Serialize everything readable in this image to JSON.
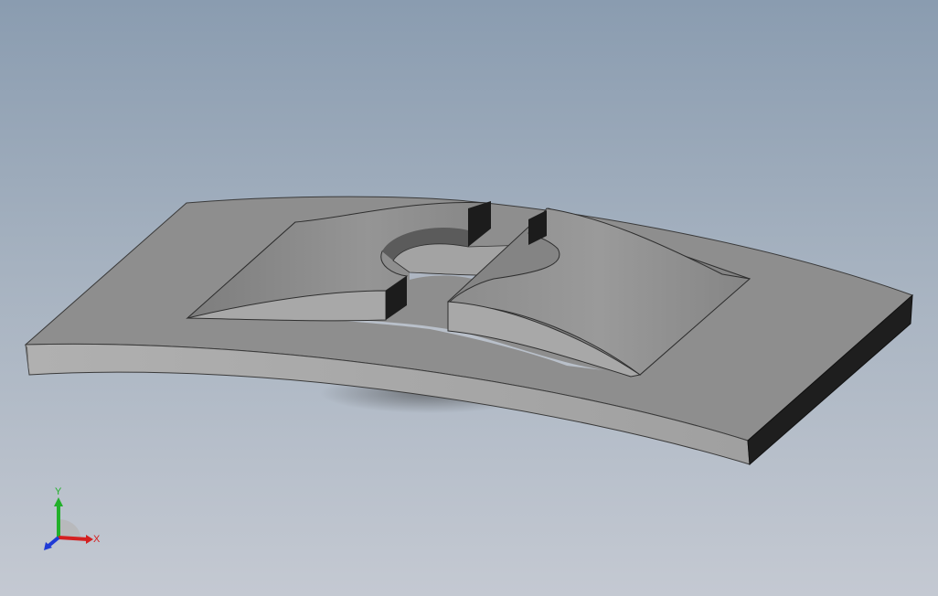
{
  "triad": {
    "x_label": "X",
    "y_label": "Y",
    "x_color": "#d42020",
    "y_color": "#22b02a",
    "z_color": "#1f3ad6"
  },
  "colors": {
    "background_top": "#8a9cb0",
    "background_bottom": "#c4c9d2",
    "part_top": "#8d8d8d",
    "part_front": "#a6a6a6",
    "part_side": "#1e1e1e"
  }
}
